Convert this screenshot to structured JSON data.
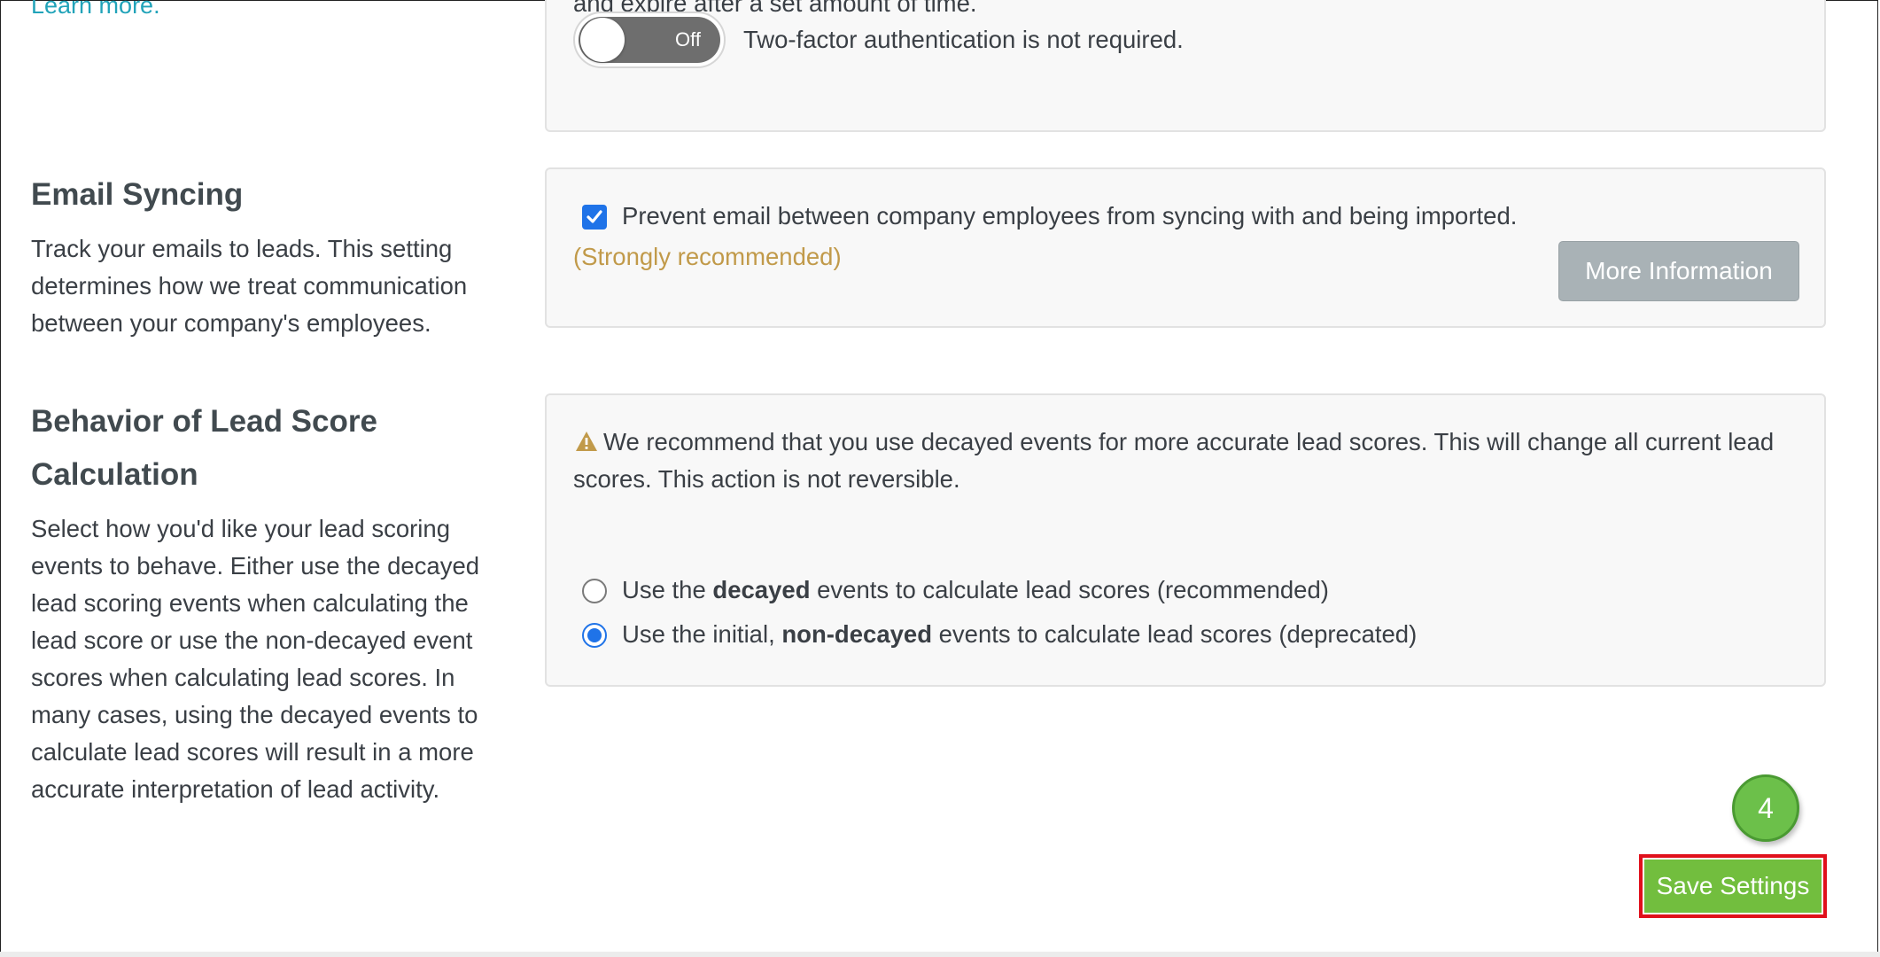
{
  "two_factor": {
    "learn_more": "Learn more.",
    "partial_text": "and expire after a set amount of time.",
    "toggle_state": "Off",
    "status_text": "Two-factor authentication is not required."
  },
  "email_syncing": {
    "title": "Email Syncing",
    "description": "Track your emails to leads. This setting determines how we treat communication between your company's employees.",
    "checkbox_label": "Prevent email between company employees from syncing with and being imported.",
    "checkbox_checked": true,
    "recommendation": "(Strongly recommended)",
    "more_info_button": "More Information"
  },
  "lead_score": {
    "title": "Behavior of Lead Score Calculation",
    "description": "Select how you'd like your lead scoring events to behave. Either use the decayed lead scoring events when calculating the lead score or use the non-decayed event scores when calculating lead scores. In many cases, using the decayed events to calculate lead scores will result in a more accurate interpretation of lead activity.",
    "warning": "We recommend that you use decayed events for more accurate lead scores. This will change all current lead scores. This action is not reversible.",
    "options": [
      {
        "prefix": "Use the ",
        "bold": "decayed",
        "suffix": " events to calculate lead scores (recommended)",
        "checked": false
      },
      {
        "prefix": "Use the initial, ",
        "bold": "non-decayed",
        "suffix": " events to calculate lead scores (deprecated)",
        "checked": true
      }
    ]
  },
  "footer": {
    "step_number": "4",
    "save_button": "Save Settings"
  },
  "colors": {
    "accent_blue": "#1f73e8",
    "link_teal": "#21a3b9",
    "save_green": "#72be3e",
    "highlight_red": "#e0101b",
    "recommend_gold": "#c19a4a"
  }
}
